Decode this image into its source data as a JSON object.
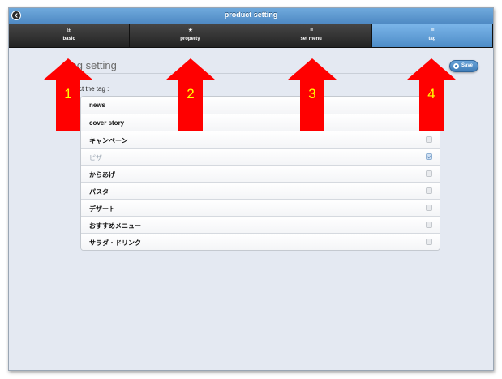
{
  "window": {
    "title": "product setting"
  },
  "tabs": [
    {
      "label": "basic",
      "icon": "grid-icon",
      "active": false
    },
    {
      "label": "property",
      "icon": "star-icon",
      "active": false
    },
    {
      "label": "set menu",
      "icon": "list-icon",
      "active": false
    },
    {
      "label": "tag",
      "icon": "list-icon",
      "active": true
    }
  ],
  "page": {
    "heading": "Tag setting",
    "save_label": "Save",
    "select_label": "Select the tag :"
  },
  "tags": [
    {
      "name": "news",
      "checked": false,
      "dim": false
    },
    {
      "name": "cover story",
      "checked": false,
      "dim": false
    },
    {
      "name": "キャンペーン",
      "checked": false,
      "dim": false
    },
    {
      "name": "ピザ",
      "checked": true,
      "dim": true
    },
    {
      "name": "からあげ",
      "checked": false,
      "dim": false
    },
    {
      "name": "パスタ",
      "checked": false,
      "dim": false
    },
    {
      "name": "デザート",
      "checked": false,
      "dim": false
    },
    {
      "name": "おすすめメニュー",
      "checked": false,
      "dim": false
    },
    {
      "name": "サラダ・ドリンク",
      "checked": false,
      "dim": false
    }
  ],
  "annotations": [
    "1",
    "2",
    "3",
    "4"
  ],
  "colors": {
    "arrow": "#ff0000",
    "number": "#ffff00",
    "accent": "#4f8ac4"
  }
}
